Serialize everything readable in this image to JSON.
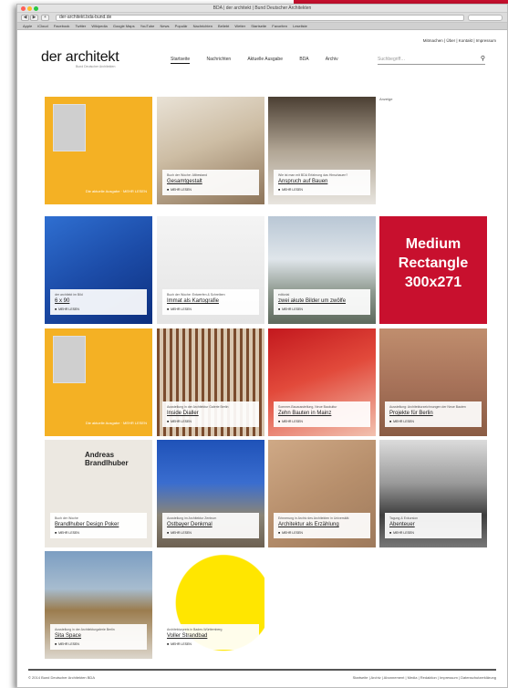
{
  "browser": {
    "title": "BDA | der architekt | Bund Deutscher Architekten",
    "url": "der-architekt.bda-bund.de",
    "bookmarks": [
      "Apple",
      "iCloud",
      "Facebook",
      "Twitter",
      "Wikipedia",
      "Google Maps",
      "YouTube",
      "News",
      "Populär",
      "Nachrichten",
      "Beliebt",
      "Wetter",
      "Startseite",
      "Favoriten",
      "Leseliste"
    ]
  },
  "site": {
    "logo": "der architekt",
    "logo_subtitle": "Bund Deutscher Architekten",
    "service_nav": "Mitmachen | Über | Kontakt | Impressum",
    "nav": [
      "Startseite",
      "Nachrichten",
      "Aktuelle Ausgabe",
      "BDA",
      "Archiv"
    ],
    "search_placeholder": "Suchbegriff…",
    "ad_label": "Anzeige",
    "more_label": "MEHR LESEN"
  },
  "tiles": {
    "mag1": {
      "link": "Die aktuelle Ausgabe · MEHR LESEN"
    },
    "t_gesamtgestalt": {
      "kicker": "Buch der Woche: Altbestand",
      "title": "Gesamtgestalt"
    },
    "t_anspruch": {
      "kicker": "Wie ist man mit BDA Erfahrung das Hinschauen?",
      "title": "Anspruch auf Bauen"
    },
    "t_6x90": {
      "kicker": "der architekt im Bild",
      "title": "6 x 90"
    },
    "t_immat": {
      "kicker": "Buch der Woche: Entwerfen & Schreiben",
      "title": "Immat als Kartografie"
    },
    "t_zwei": {
      "kicker": "editorial",
      "title": "zwei akute Bilder um zwölfe"
    },
    "mag2": {
      "link": "Die aktuelle Ausgabe · MEHR LESEN"
    },
    "t_inside": {
      "kicker": "Ausstellung in der Architektur Galerie Berlin",
      "title": "Inside Dialler"
    },
    "t_zehn": {
      "kicker": "Sommer-Bauausstellung, Neue Baukultur",
      "title": "Zehn Bauten in Mainz"
    },
    "t_projekte": {
      "kicker": "Ausstellung: Architekturzeichnungen der Neue Bauten",
      "title": "Projekte für Berlin"
    },
    "t_brandlhuber": {
      "kicker": "Buch der Woche",
      "title": "Brandlhuber Design Poker",
      "overlay": "Andreas Brandlhuber"
    },
    "t_ostbayer": {
      "kicker": "Ausstellung im Architektur Zentrum",
      "title": "Ostbayer Denkmal"
    },
    "t_architektur": {
      "kicker": "Erinnerung in Archiv des Architekten in Universität",
      "title": "Architektur als Erzählung"
    },
    "t_abenteuer": {
      "kicker": "Tagung & Exkursion",
      "title": "Abenteuer"
    },
    "t_sita": {
      "kicker": "Ausstellung in der Architekturgalerie Berlin",
      "title": "Sita Space"
    },
    "t_voller": {
      "kicker": "Architekturpreis in Baden-Württemberg",
      "title": "Voller Strandbad"
    }
  },
  "ad": {
    "lines": [
      "Medium",
      "Rectangle",
      "300x271"
    ]
  },
  "footer": {
    "copyright": "© 2014 Bund Deutscher Architekten BDA",
    "links": "Startseite  |  Archiv  |  Abonnement  |  Media  |  Redaktion  |  Impressum  |  Datenschutzerklärung"
  }
}
